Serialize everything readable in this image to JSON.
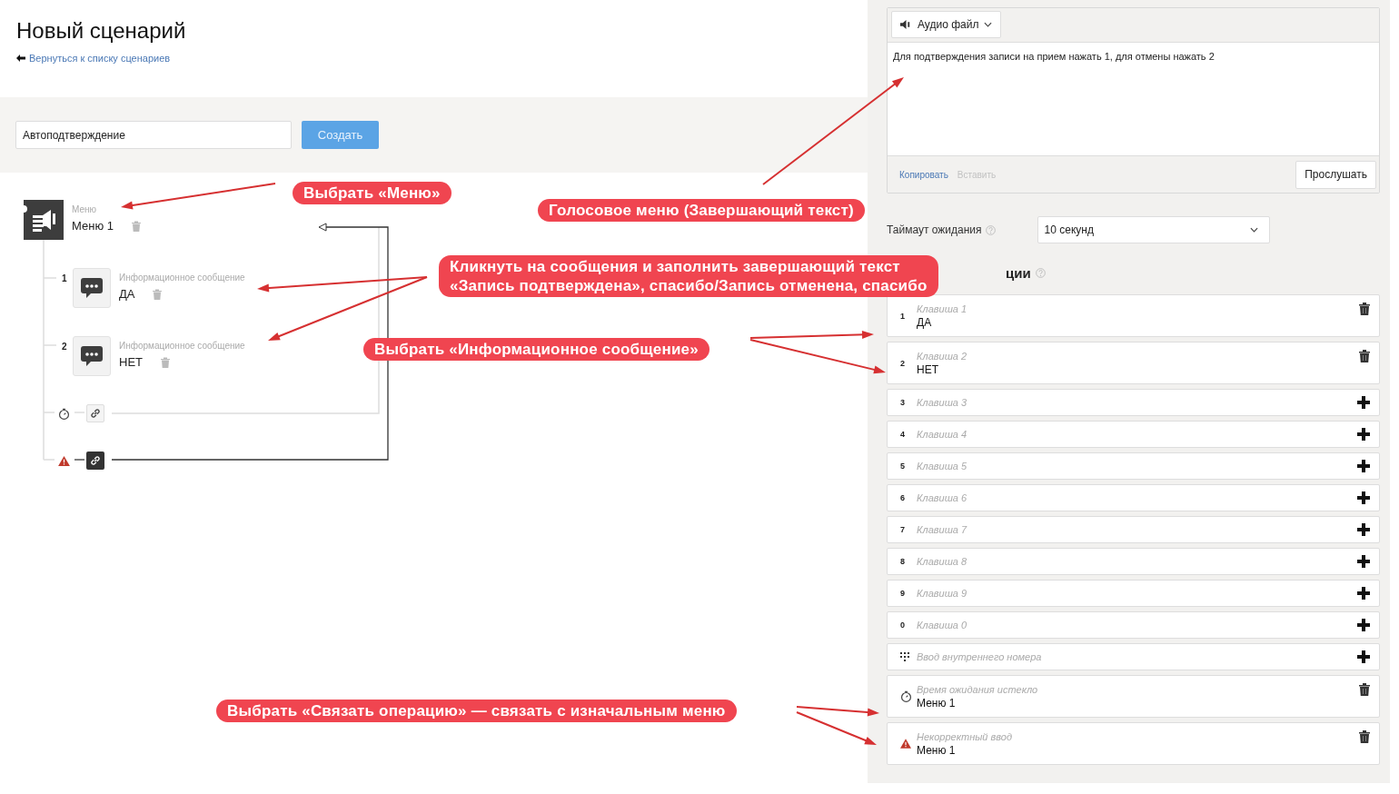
{
  "page": {
    "title": "Новый сценарий",
    "back_link": "Вернуться к списку сценариев"
  },
  "create_form": {
    "name_value": "Автоподтверждение",
    "button": "Создать"
  },
  "tree": {
    "root": {
      "type_label": "Меню",
      "name": "Меню 1"
    },
    "children": [
      {
        "kind": "message",
        "number": "1",
        "type_label": "Информационное сообщение",
        "name": "ДА"
      },
      {
        "kind": "message",
        "number": "2",
        "type_label": "Информационное сообщение",
        "name": "НЕТ"
      },
      {
        "kind": "timeout"
      },
      {
        "kind": "invalid"
      }
    ]
  },
  "editor": {
    "source_dropdown": "Аудио файл",
    "text": "Для подтверждения записи на прием нажать 1, для отмены нажать 2",
    "actions": [
      {
        "label": "Копировать",
        "disabled": false
      },
      {
        "label": "Вставить",
        "disabled": true
      }
    ],
    "play_button": "Прослушать"
  },
  "timeout": {
    "label": "Таймаут ожидания",
    "value": "10 секунд"
  },
  "section_heading": "ции",
  "keys": [
    {
      "kind": "key",
      "key": "1",
      "label": "Клавиша 1",
      "value": "ДА",
      "assigned": true
    },
    {
      "kind": "key",
      "key": "2",
      "label": "Клавиша 2",
      "value": "НЕТ",
      "assigned": true
    },
    {
      "kind": "key",
      "key": "3",
      "label": "Клавиша 3",
      "assigned": false
    },
    {
      "kind": "key",
      "key": "4",
      "label": "Клавиша 4",
      "assigned": false
    },
    {
      "kind": "key",
      "key": "5",
      "label": "Клавиша 5",
      "assigned": false
    },
    {
      "kind": "key",
      "key": "6",
      "label": "Клавиша 6",
      "assigned": false
    },
    {
      "kind": "key",
      "key": "7",
      "label": "Клавиша 7",
      "assigned": false
    },
    {
      "kind": "key",
      "key": "8",
      "label": "Клавиша 8",
      "assigned": false
    },
    {
      "kind": "key",
      "key": "9",
      "label": "Клавиша 9",
      "assigned": false
    },
    {
      "kind": "key",
      "key": "0",
      "label": "Клавиша 0",
      "assigned": false
    },
    {
      "kind": "extension",
      "label": "Ввод внутреннего номера",
      "assigned": false
    },
    {
      "kind": "timeout",
      "label": "Время ожидания истекло",
      "value": "Меню 1",
      "assigned": true
    },
    {
      "kind": "invalid",
      "label": "Некорректный ввод",
      "value": "Меню 1",
      "assigned": true
    }
  ],
  "annotations": [
    {
      "lines": [
        "Выбрать «Меню»"
      ]
    },
    {
      "lines": [
        "Голосовое меню (Завершающий текст)"
      ]
    },
    {
      "lines": [
        "Кликнуть на сообщения и заполнить завершающий текст",
        "«Запись подтверждена», спасибо/Запись отменена, спасибо"
      ]
    },
    {
      "lines": [
        "Выбрать «Информационное сообщение»"
      ]
    },
    {
      "lines": [
        "Выбрать «Связать операцию» — связать с изначальным меню"
      ]
    }
  ]
}
